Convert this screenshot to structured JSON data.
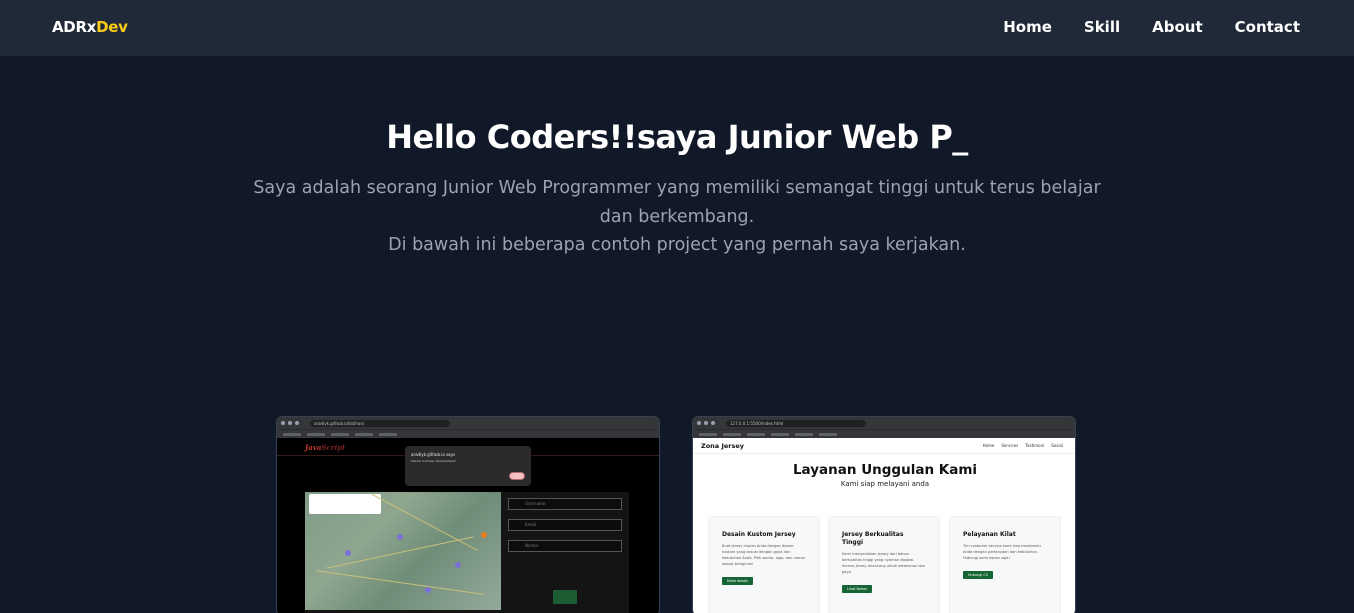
{
  "navbar": {
    "brand_main": "ADRx",
    "brand_accent": "Dev",
    "links": [
      "Home",
      "Skill",
      "About",
      "Contact"
    ]
  },
  "hero": {
    "title": "Hello Coders!!saya Junior Web P_",
    "description_line_1": "Saya adalah seorang Junior Web Programmer yang memiliki semangat tinggi untuk terus belajar",
    "description_line_2": "dan berkembang.",
    "description_line_3": "Di bawah ini beberapa contoh project yang pernah saya kerjakan."
  },
  "projects": [
    {
      "url": "aradiyk.github.io/latihan/",
      "dialog_title": "aradiyk.github.io says",
      "dialog_text": "Marker berhasil ditambahkan!",
      "logo_main": "Java",
      "logo_accent": "Script",
      "fields": [
        "Username",
        "Email",
        "Nomor"
      ],
      "submit_label": "Kirim"
    },
    {
      "url": "127.0.0.1:5500/index.html",
      "logo": "Zona Jersey",
      "nav_links": [
        "Home",
        "Services",
        "Testimoni",
        "Sosial"
      ],
      "title": "Layanan Unggulan Kami",
      "tagline": "Kami siap melayani anda",
      "services": [
        {
          "heading": "Desain Kustom Jersey",
          "text": "Buat jersey impian Anda dengan desain kustom yang sesuai dengan gaya dan kebutuhan Anda. Pilih warna, logo, dan nomor sesuai keinginan!",
          "button": "Mulai desain"
        },
        {
          "heading": "Jersey Berkualitas Tinggi",
          "text": "Kami menyediakan jersey dari bahan berkualitas tinggi yang nyaman dipakai. Semua jersey dirancang untuk ketahanan dan gaya.",
          "button": "Lihat Bahan"
        },
        {
          "heading": "Pelayanan Kilat",
          "text": "Tim customer service kami siap membantu Anda dengan pertanyaan dan kebutuhan. Hubungi kami kapan saja!",
          "button": "Hubungi CS"
        }
      ]
    }
  ]
}
